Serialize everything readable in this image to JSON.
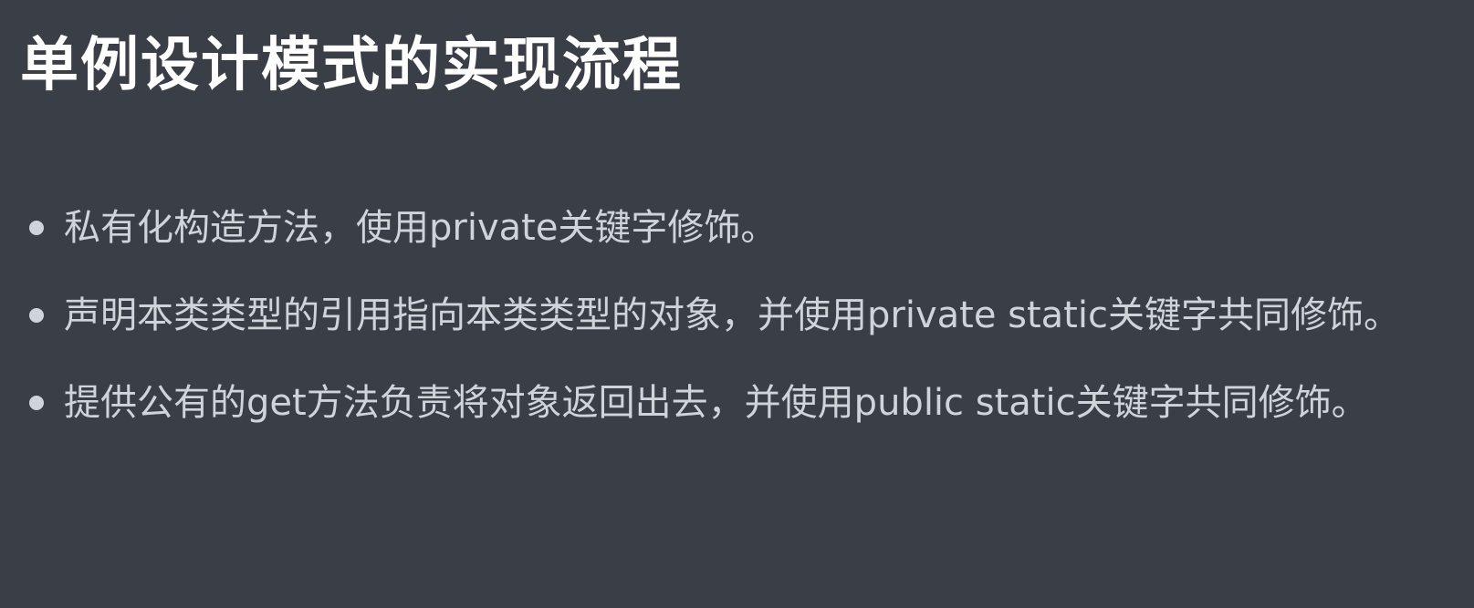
{
  "slide": {
    "title": "单例设计模式的实现流程",
    "bullets": [
      {
        "text": "私有化构造方法，使用private关键字修饰。"
      },
      {
        "text": "声明本类类型的引用指向本类类型的对象，并使用private static关键字共同修饰。"
      },
      {
        "text": "提供公有的get方法负责将对象返回出去，并使用public static关键字共同修饰。"
      }
    ]
  }
}
